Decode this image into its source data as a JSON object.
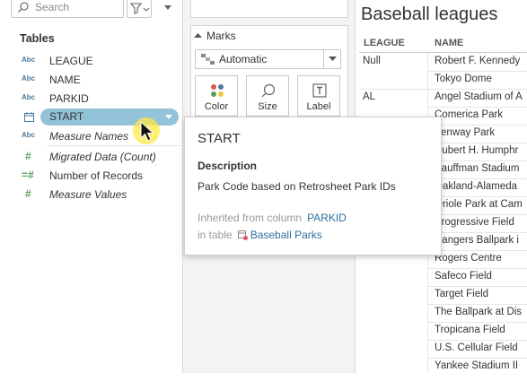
{
  "search": {
    "placeholder": "Search"
  },
  "tables": {
    "header": "Tables",
    "fields": [
      {
        "type_icon": "Abc",
        "label": "LEAGUE",
        "italic": false
      },
      {
        "type_icon": "Abc",
        "label": "NAME",
        "italic": false
      },
      {
        "type_icon": "Abc",
        "label": "PARKID",
        "italic": false
      },
      {
        "type_icon": "calendar-icon",
        "label": "START",
        "italic": false,
        "selected": true
      },
      {
        "type_icon": "Abc",
        "label": "Measure Names",
        "italic": true
      },
      {
        "type_icon": "#",
        "label": "Migrated Data (Count)",
        "italic": true
      },
      {
        "type_icon": "=#",
        "label": "Number of Records",
        "italic": false
      },
      {
        "type_icon": "#",
        "label": "Measure Values",
        "italic": true
      }
    ]
  },
  "marks": {
    "title": "Marks",
    "mark_type": "Automatic",
    "buttons": [
      "Color",
      "Size",
      "Label"
    ]
  },
  "viz": {
    "title": "Baseball leagues",
    "columns": [
      "LEAGUE",
      "NAME"
    ],
    "leagues": [
      "Null",
      "AL"
    ],
    "names": [
      "Robert F. Kennedy",
      "Tokyo Dome",
      "Angel Stadium of A",
      "Comerica Park",
      "Fenway Park",
      "Hubert H. Humphr",
      "Kauffman Stadium",
      "Oakland-Alameda",
      "Oriole Park at Cam",
      "Progressive Field",
      "Rangers Ballpark i",
      "Rogers Centre",
      "Safeco Field",
      "Target Field",
      "The Ballpark at Dis",
      "Tropicana Field",
      "U.S. Cellular Field",
      "Yankee Stadium II"
    ]
  },
  "tooltip": {
    "title": "START",
    "description_heading": "Description",
    "description": "Park Code based on Retrosheet Park IDs",
    "inherited_label": "Inherited from column",
    "inherited_column": "PARKID",
    "table_label": "in table",
    "table_name": "Baseball Parks"
  },
  "colors": {
    "selected_pill": "#93c3d8",
    "link": "#2e6f9e",
    "highlight": "#ffe846"
  }
}
